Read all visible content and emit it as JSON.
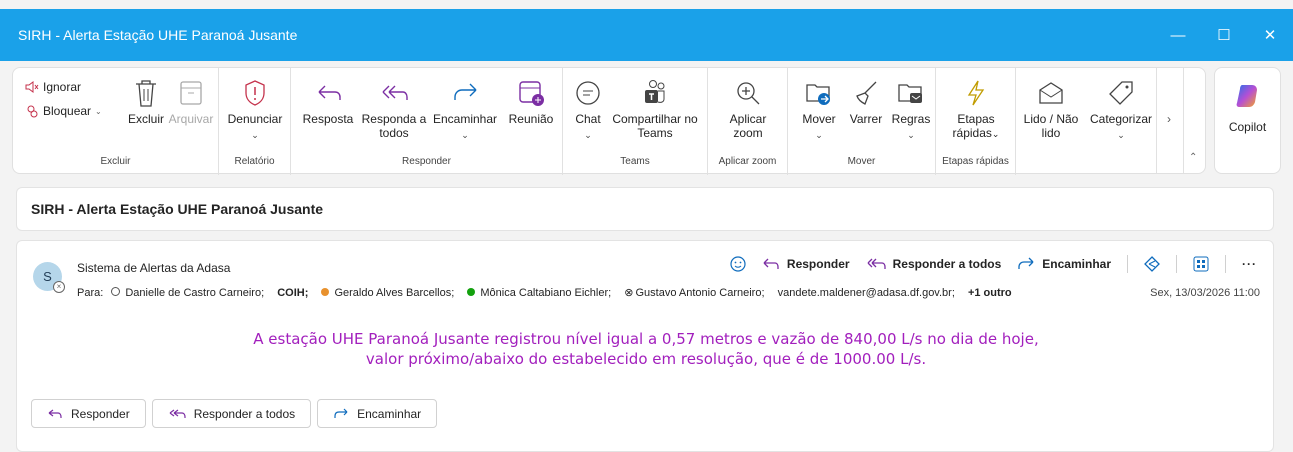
{
  "window": {
    "title": "SIRH - Alerta Estação UHE Paranoá Jusante"
  },
  "ribbon": {
    "excluir_group": {
      "label": "Excluir",
      "ignorar": "Ignorar",
      "bloquear": "Bloquear",
      "excluir": "Excluir",
      "arquivar": "Arquivar"
    },
    "relatorio_group": {
      "label": "Relatório",
      "denunciar": "Denunciar"
    },
    "responder_group": {
      "label": "Responder",
      "resposta": "Resposta",
      "responda_todos_l1": "Responda a",
      "responda_todos_l2": "todos",
      "encaminhar": "Encaminhar",
      "reuniao": "Reunião"
    },
    "teams_group": {
      "label": "Teams",
      "chat": "Chat",
      "compartilhar_l1": "Compartilhar no",
      "compartilhar_l2": "Teams"
    },
    "zoom_group": {
      "label": "Aplicar zoom",
      "aplicar_l1": "Aplicar",
      "aplicar_l2": "zoom"
    },
    "mover_group": {
      "label": "Mover",
      "mover": "Mover",
      "varrer": "Varrer",
      "regras": "Regras"
    },
    "etapas_group": {
      "label": "Etapas rápidas",
      "etapas_l1": "Etapas",
      "etapas_l2": "rápidas"
    },
    "tags": {
      "lido_l1": "Lido / Não",
      "lido_l2": "lido",
      "categorizar": "Categorizar"
    },
    "copilot": "Copilot"
  },
  "subject": "SIRH - Alerta Estação UHE Paranoá Jusante",
  "message": {
    "avatar_initial": "S",
    "sender": "Sistema de Alertas da Adasa",
    "to_label": "Para:",
    "recipients": [
      "Danielle de Castro Carneiro;",
      "COIH;",
      "Geraldo Alves Barcellos;",
      "Mônica Caltabiano Eichler;",
      "Gustavo Antonio Carneiro;",
      "vandete.maldener@adasa.df.gov.br;",
      "+1 outro"
    ],
    "date": "Sex, 13/03/2026 11:00",
    "actions": {
      "responder": "Responder",
      "responder_todos": "Responder a todos",
      "encaminhar": "Encaminhar"
    },
    "body_line1": "A estação UHE Paranoá Jusante registrou nível igual a 0,57 metros e vazão de 840,00 L/s no dia de hoje,",
    "body_line2": "valor próximo/abaixo do estabelecido em resolução, que é de 1000.00 L/s.",
    "footer": {
      "responder": "Responder",
      "responder_todos": "Responder a todos",
      "encaminhar": "Encaminhar"
    }
  },
  "colors": {
    "titlebar": "#1aa1e9",
    "body_text": "#a21fbd",
    "accent": "#0f6cbd"
  }
}
